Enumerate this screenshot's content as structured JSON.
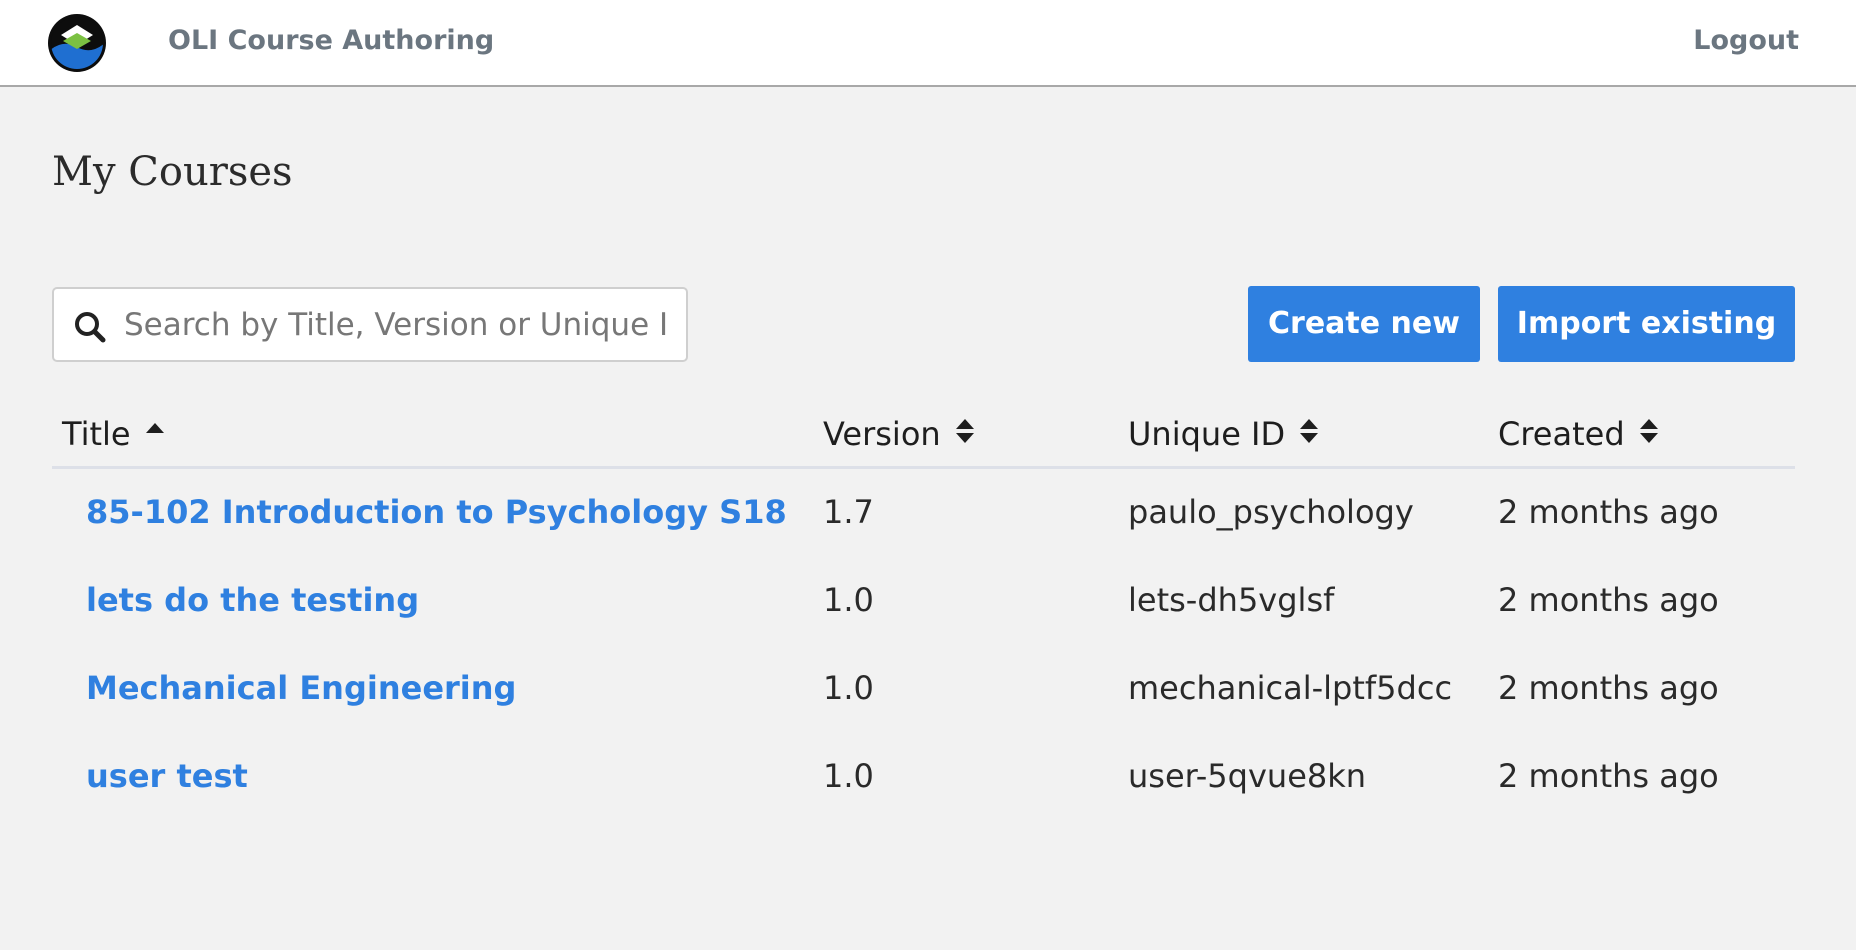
{
  "header": {
    "app_title": "OLI Course Authoring",
    "logout_label": "Logout",
    "logo_icon": "oli-logo-icon"
  },
  "main": {
    "page_title": "My Courses",
    "search": {
      "placeholder": "Search by Title, Version or Unique ID",
      "value": "",
      "icon": "search-icon"
    },
    "buttons": {
      "create_label": "Create new",
      "import_label": "Import existing"
    },
    "colors": {
      "accent": "#2f80e0",
      "header_text": "#6b7680",
      "background": "#f2f2f2"
    },
    "table": {
      "columns": [
        {
          "label": "Title",
          "sort": "ascending"
        },
        {
          "label": "Version",
          "sort": "unsorted"
        },
        {
          "label": "Unique ID",
          "sort": "unsorted"
        },
        {
          "label": "Created",
          "sort": "unsorted"
        }
      ],
      "rows": [
        {
          "title": "85-102 Introduction to Psychology S18",
          "version": "1.7",
          "unique_id": "paulo_psychology",
          "created": "2 months ago"
        },
        {
          "title": "lets do the testing",
          "version": "1.0",
          "unique_id": "lets-dh5vglsf",
          "created": "2 months ago"
        },
        {
          "title": "Mechanical Engineering",
          "version": "1.0",
          "unique_id": "mechanical-lptf5dcc",
          "created": "2 months ago"
        },
        {
          "title": "user test",
          "version": "1.0",
          "unique_id": "user-5qvue8kn",
          "created": "2 months ago"
        }
      ]
    }
  }
}
